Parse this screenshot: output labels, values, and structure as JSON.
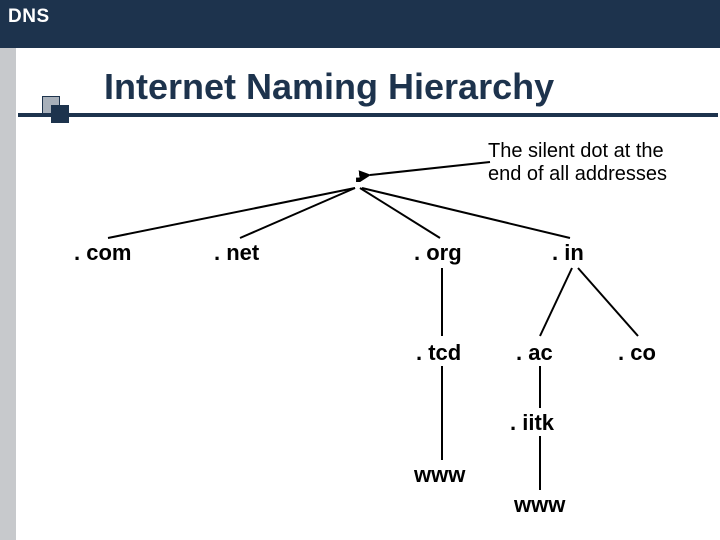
{
  "header": {
    "title": "DNS"
  },
  "title": "Internet Naming Hierarchy",
  "note": "The silent dot at the end of all addresses",
  "tree": {
    "root": ".",
    "com": ". com",
    "net": ". net",
    "org": ". org",
    "in": ". in",
    "tcd": ". tcd",
    "ac": ". ac",
    "co": ". co",
    "iitk": ". iitk",
    "www1": "www",
    "www2": "www"
  }
}
